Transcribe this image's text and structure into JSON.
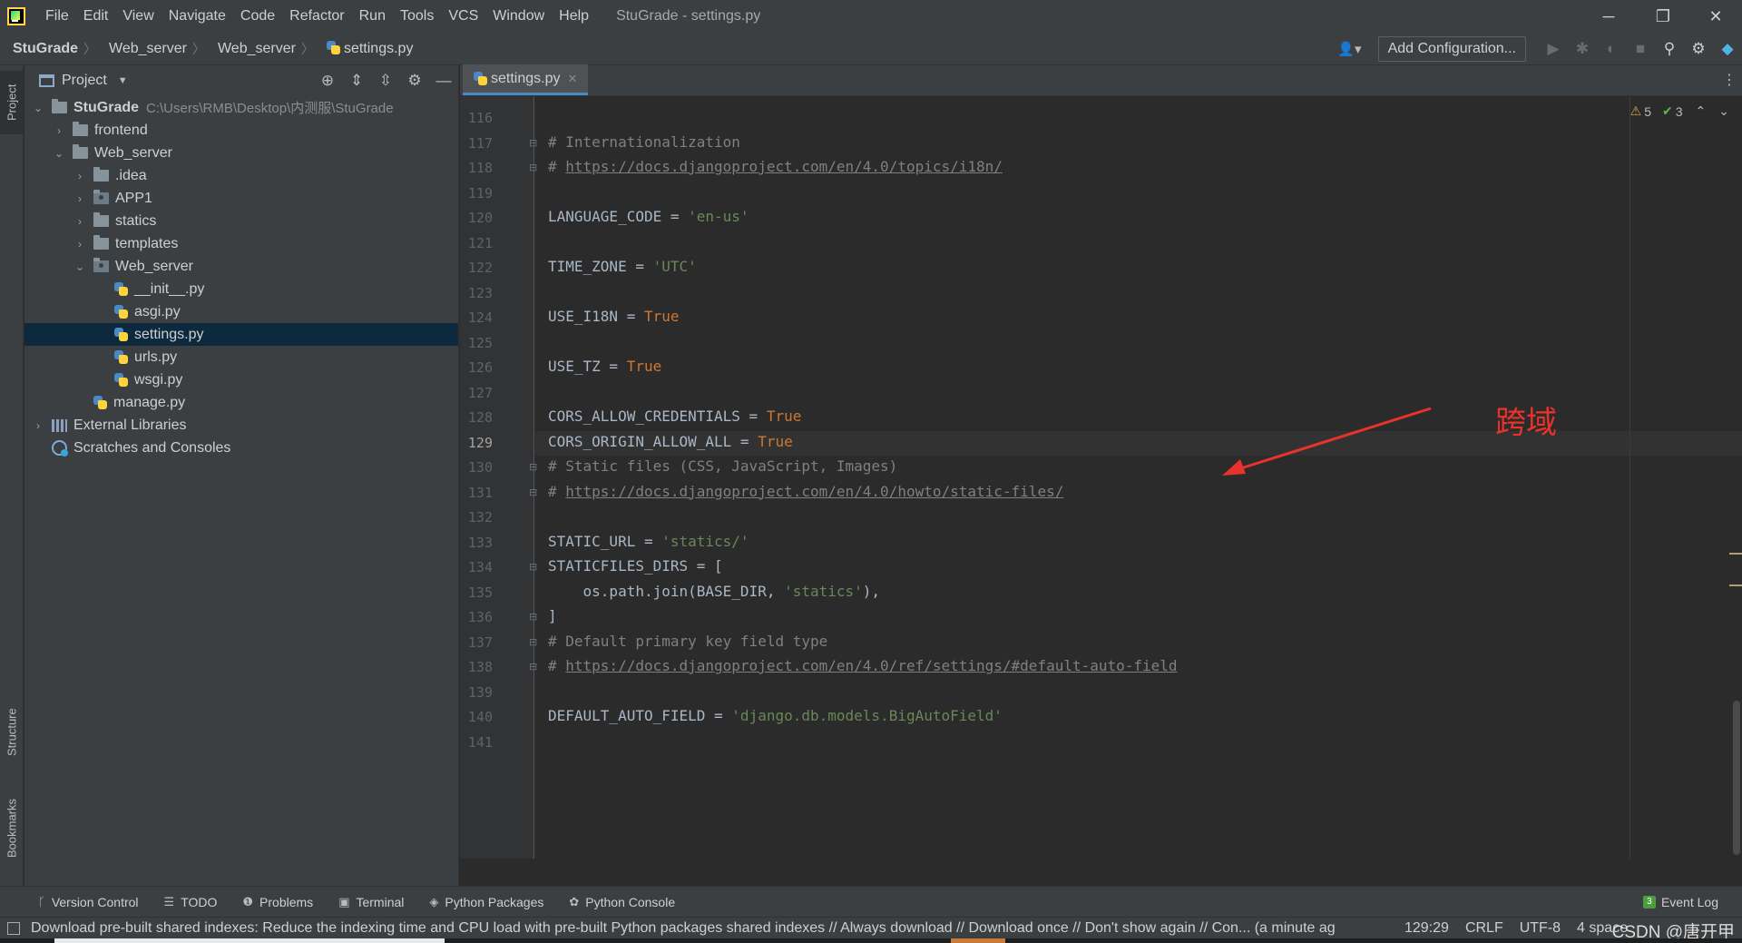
{
  "menubar": {
    "items": [
      "File",
      "Edit",
      "View",
      "Navigate",
      "Code",
      "Refactor",
      "Run",
      "Tools",
      "VCS",
      "Window",
      "Help"
    ],
    "window_title": "StuGrade - settings.py",
    "controls": {
      "minimize": "─",
      "restore": "❐",
      "close": "✕"
    }
  },
  "navbar": {
    "breadcrumbs": [
      "StuGrade",
      "Web_server",
      "Web_server",
      "settings.py"
    ],
    "add_configuration_label": "Add Configuration...",
    "icons": [
      "user-icon",
      "run-icon",
      "debug-icon",
      "coverage-icon",
      "stop-icon",
      "search-icon",
      "settings-icon",
      "toolbox-icon"
    ]
  },
  "left_stripe": {
    "project": "Project",
    "structure": "Structure",
    "bookmarks": "Bookmarks"
  },
  "project_panel": {
    "title": "Project",
    "tree": [
      {
        "label": "StuGrade",
        "hint": "C:\\Users\\RMB\\Desktop\\内测服\\StuGrade",
        "depth": 0,
        "chevron": "down",
        "icon": "folder",
        "bold": true
      },
      {
        "label": "frontend",
        "depth": 1,
        "chevron": "right",
        "icon": "folder"
      },
      {
        "label": "Web_server",
        "depth": 1,
        "chevron": "down",
        "icon": "folder"
      },
      {
        "label": ".idea",
        "depth": 2,
        "chevron": "right",
        "icon": "folder"
      },
      {
        "label": "APP1",
        "depth": 2,
        "chevron": "right",
        "icon": "package"
      },
      {
        "label": "statics",
        "depth": 2,
        "chevron": "right",
        "icon": "folder"
      },
      {
        "label": "templates",
        "depth": 2,
        "chevron": "right",
        "icon": "folder"
      },
      {
        "label": "Web_server",
        "depth": 2,
        "chevron": "down",
        "icon": "package"
      },
      {
        "label": "__init__.py",
        "depth": 3,
        "chevron": "none",
        "icon": "python"
      },
      {
        "label": "asgi.py",
        "depth": 3,
        "chevron": "none",
        "icon": "python"
      },
      {
        "label": "settings.py",
        "depth": 3,
        "chevron": "none",
        "icon": "python",
        "selected": true
      },
      {
        "label": "urls.py",
        "depth": 3,
        "chevron": "none",
        "icon": "python"
      },
      {
        "label": "wsgi.py",
        "depth": 3,
        "chevron": "none",
        "icon": "python"
      },
      {
        "label": "manage.py",
        "depth": 2,
        "chevron": "none",
        "icon": "python"
      },
      {
        "label": "External Libraries",
        "depth": 0,
        "chevron": "right",
        "icon": "libraries"
      },
      {
        "label": "Scratches and Consoles",
        "depth": 0,
        "chevron": "none",
        "icon": "scratches"
      }
    ]
  },
  "editor": {
    "tab_label": "settings.py",
    "inspections": {
      "warnings": "5",
      "weak_warnings": "3"
    },
    "current_line": 129,
    "lines": [
      {
        "no": 116,
        "tokens": []
      },
      {
        "no": 117,
        "fold": true,
        "tokens": [
          {
            "t": "comment",
            "v": "# Internationalization"
          }
        ]
      },
      {
        "no": 118,
        "fold": true,
        "tokens": [
          {
            "t": "comment",
            "v": "# "
          },
          {
            "t": "link",
            "v": "https://docs.djangoproject.com/en/4.0/topics/i18n/"
          }
        ]
      },
      {
        "no": 119,
        "tokens": []
      },
      {
        "no": 120,
        "tokens": [
          {
            "t": "plain",
            "v": "LANGUAGE_CODE = "
          },
          {
            "t": "string",
            "v": "'en-us'"
          }
        ]
      },
      {
        "no": 121,
        "tokens": []
      },
      {
        "no": 122,
        "tokens": [
          {
            "t": "plain",
            "v": "TIME_ZONE = "
          },
          {
            "t": "string",
            "v": "'UTC'"
          }
        ]
      },
      {
        "no": 123,
        "tokens": []
      },
      {
        "no": 124,
        "tokens": [
          {
            "t": "plain",
            "v": "USE_I18N = "
          },
          {
            "t": "keyword",
            "v": "True"
          }
        ]
      },
      {
        "no": 125,
        "tokens": []
      },
      {
        "no": 126,
        "tokens": [
          {
            "t": "plain",
            "v": "USE_TZ = "
          },
          {
            "t": "keyword",
            "v": "True"
          }
        ]
      },
      {
        "no": 127,
        "tokens": []
      },
      {
        "no": 128,
        "tokens": [
          {
            "t": "plain",
            "v": "CORS_ALLOW_CREDENTIALS = "
          },
          {
            "t": "keyword",
            "v": "True"
          }
        ]
      },
      {
        "no": 129,
        "tokens": [
          {
            "t": "plain",
            "v": "CORS_ORIGIN_ALLOW_ALL = "
          },
          {
            "t": "keyword",
            "v": "True"
          }
        ]
      },
      {
        "no": 130,
        "fold": true,
        "tokens": [
          {
            "t": "comment",
            "v": "# Static files (CSS, JavaScript, Images)"
          }
        ]
      },
      {
        "no": 131,
        "fold": true,
        "tokens": [
          {
            "t": "comment",
            "v": "# "
          },
          {
            "t": "link",
            "v": "https://docs.djangoproject.com/en/4.0/howto/static-files/"
          }
        ]
      },
      {
        "no": 132,
        "tokens": []
      },
      {
        "no": 133,
        "tokens": [
          {
            "t": "plain",
            "v": "STATIC_URL = "
          },
          {
            "t": "string",
            "v": "'statics/'"
          }
        ]
      },
      {
        "no": 134,
        "fold": true,
        "tokens": [
          {
            "t": "plain",
            "v": "STATICFILES_DIRS = ["
          }
        ]
      },
      {
        "no": 135,
        "tokens": [
          {
            "t": "plain",
            "v": "    os.path.join(BASE_DIR, "
          },
          {
            "t": "string",
            "v": "'statics'"
          },
          {
            "t": "plain",
            "v": "),"
          }
        ]
      },
      {
        "no": 136,
        "fold": true,
        "tokens": [
          {
            "t": "plain",
            "v": "]"
          }
        ]
      },
      {
        "no": 137,
        "fold": true,
        "tokens": [
          {
            "t": "comment",
            "v": "# Default primary key field type"
          }
        ]
      },
      {
        "no": 138,
        "fold": true,
        "tokens": [
          {
            "t": "comment",
            "v": "# "
          },
          {
            "t": "link",
            "v": "https://docs.djangoproject.com/en/4.0/ref/settings/#default-auto-field"
          }
        ]
      },
      {
        "no": 139,
        "tokens": []
      },
      {
        "no": 140,
        "tokens": [
          {
            "t": "plain",
            "v": "DEFAULT_AUTO_FIELD = "
          },
          {
            "t": "string",
            "v": "'django.db.models.BigAutoField'"
          }
        ]
      },
      {
        "no": 141,
        "tokens": []
      }
    ],
    "annotation": "跨域"
  },
  "bottom_tabs": [
    {
      "label": "Version Control",
      "icon": "branch-icon",
      "glyph": "ᚴ"
    },
    {
      "label": "TODO",
      "icon": "list-icon",
      "glyph": "☰"
    },
    {
      "label": "Problems",
      "icon": "problems-icon",
      "glyph": "❶"
    },
    {
      "label": "Terminal",
      "icon": "terminal-icon",
      "glyph": "▣"
    },
    {
      "label": "Python Packages",
      "icon": "packages-icon",
      "glyph": "◈"
    },
    {
      "label": "Python Console",
      "icon": "python-console-icon",
      "glyph": "✿"
    }
  ],
  "event_log": {
    "label": "Event Log",
    "count": "3"
  },
  "status_bar": {
    "message": "Download pre-built shared indexes: Reduce the indexing time and CPU load with pre-built Python packages shared indexes // Always download // Download once // Don't show again // Con... (a minute ag",
    "position": "129:29",
    "line_separator": "CRLF",
    "encoding": "UTF-8",
    "indent": "4 space",
    "watermark": "CSDN @唐开甲"
  },
  "colors": {
    "keyword": "#cc7832",
    "string": "#6a8759",
    "comment": "#808080",
    "plain": "#a9b7c6",
    "annotation": "#e8322c",
    "selection": "#0d293e",
    "accent": "#4a88c7"
  }
}
